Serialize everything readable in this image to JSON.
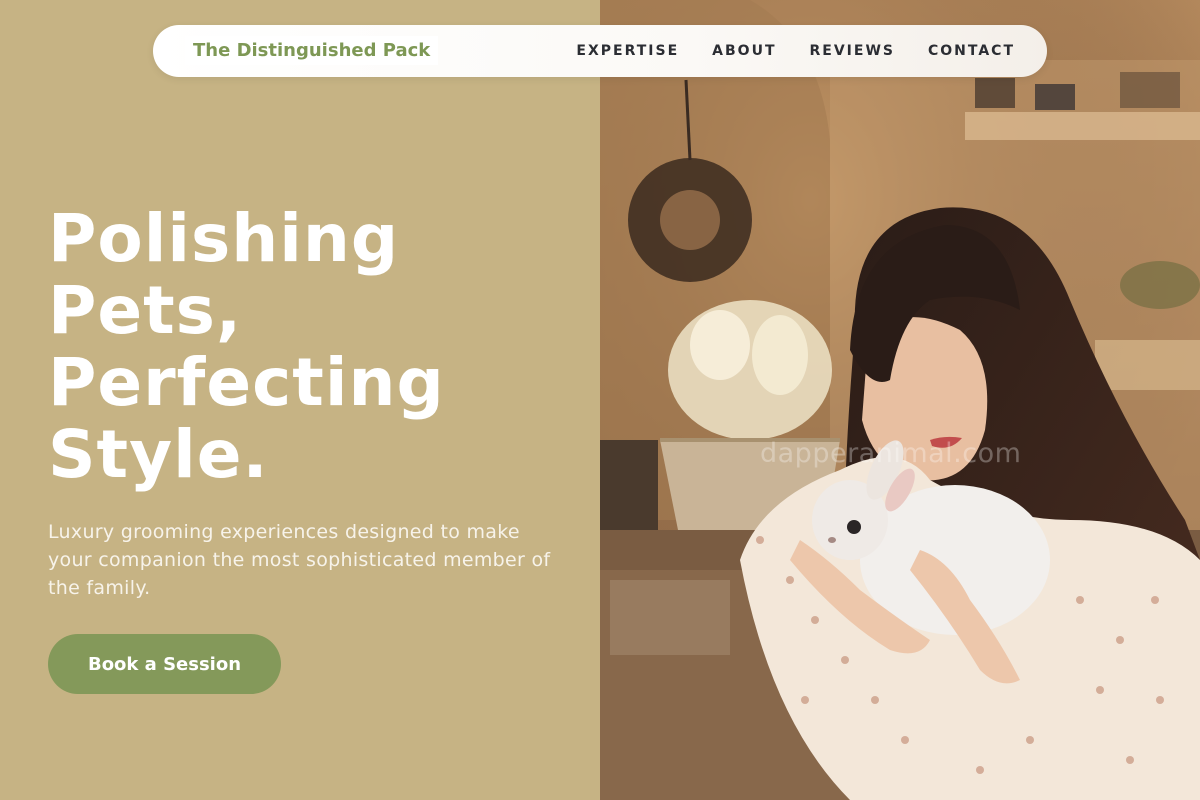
{
  "brand": {
    "name": "The Distinguished Pack"
  },
  "nav": {
    "links": [
      "EXPERTISE",
      "ABOUT",
      "REVIEWS",
      "CONTACT"
    ]
  },
  "hero": {
    "title_lines": [
      "Polishing",
      "Pets,",
      "Perfecting",
      "Style."
    ],
    "subtitle": "Luxury grooming experiences designed to make your companion the most sophisticated member of the family.",
    "cta_label": "Book a Session"
  },
  "photo": {
    "watermark": "dapperanimal.com"
  },
  "colors": {
    "left_panel": "#c6b384",
    "brand_text": "#7e9855",
    "cta_background": "#84995a",
    "nav_text": "#2b2d33",
    "headline": "#ffffff"
  }
}
